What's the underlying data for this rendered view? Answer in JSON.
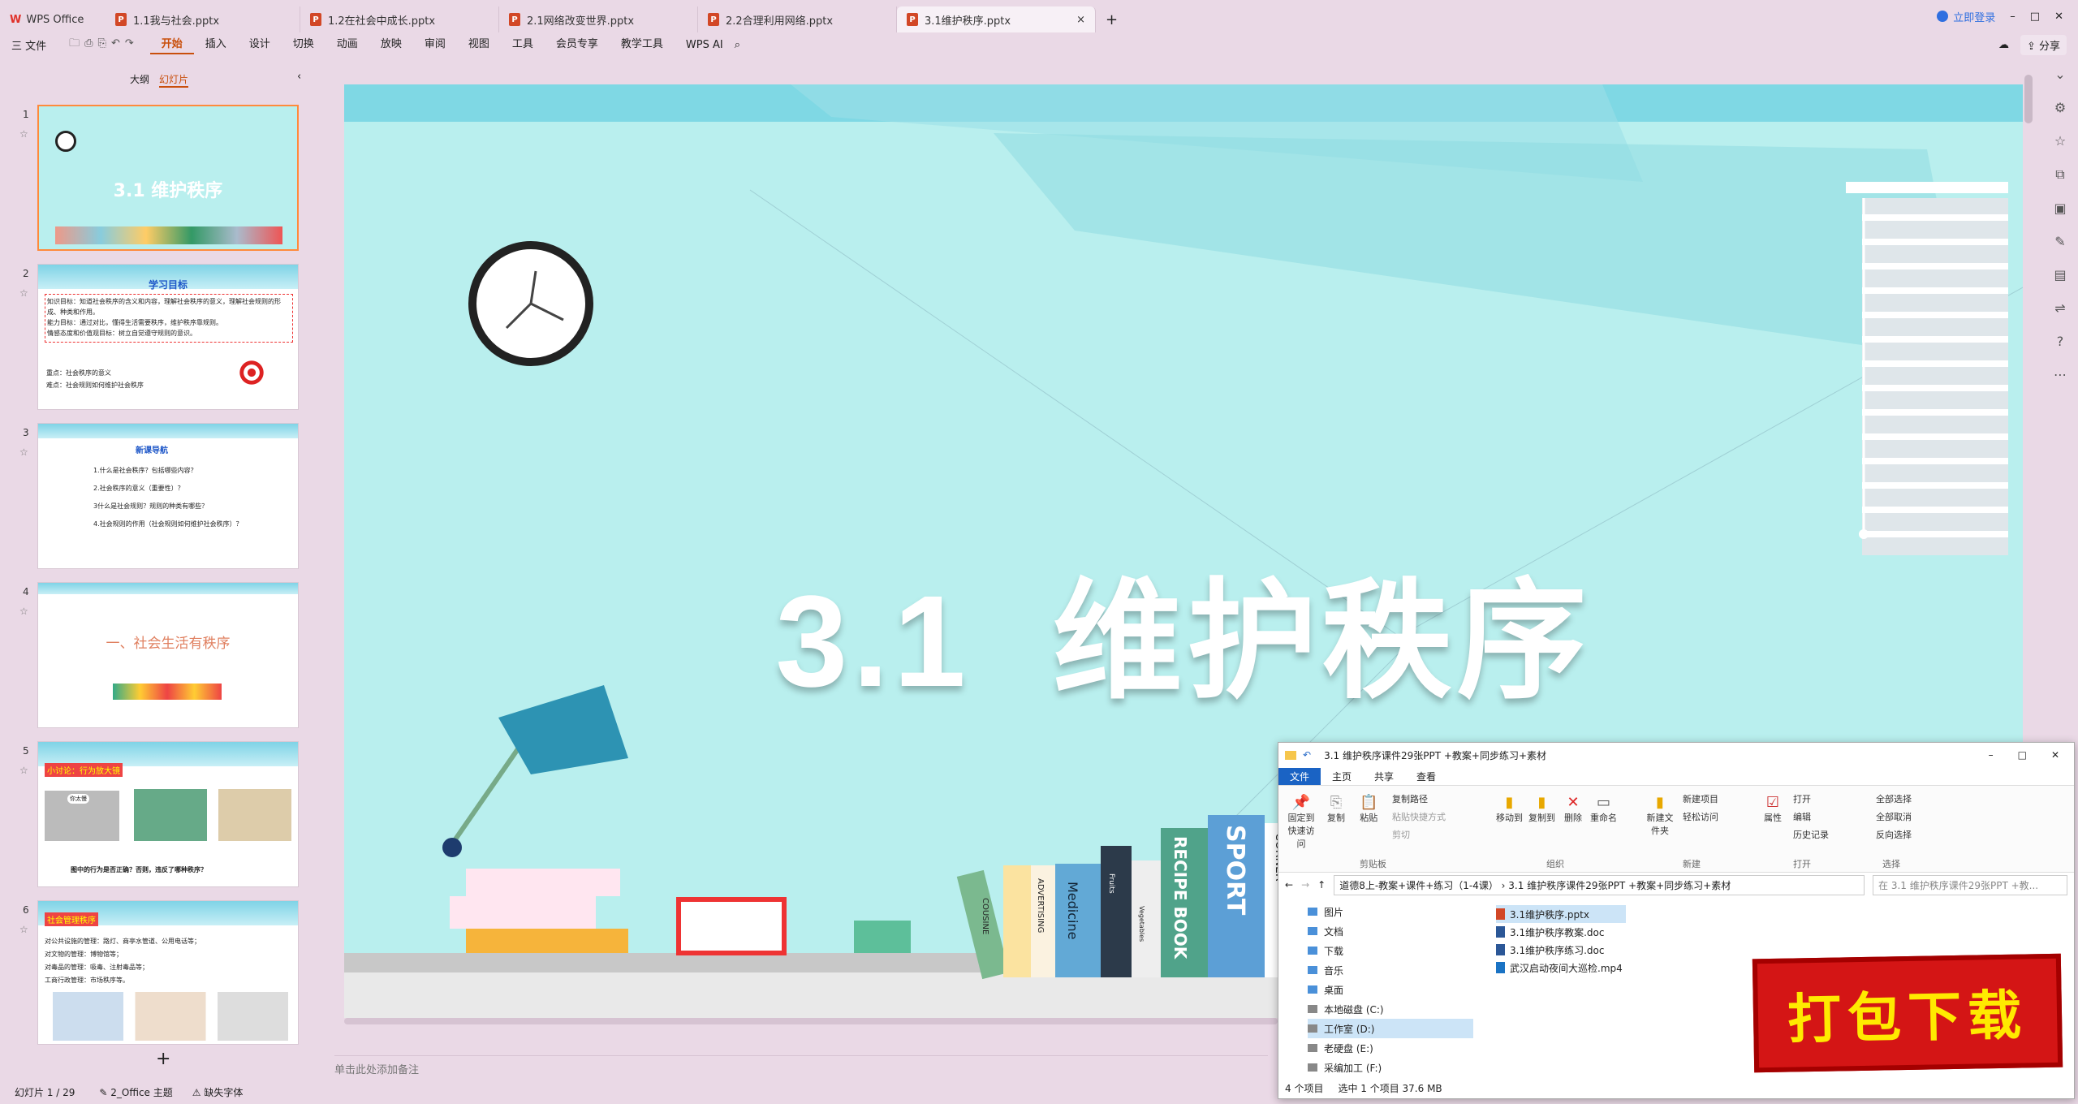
{
  "tabs": {
    "wps": "WPS Office",
    "t1": "1.1我与社会.pptx",
    "t2": "1.2在社会中成长.pptx",
    "t3": "2.1网络改变世界.pptx",
    "t4": "2.2合理利用网络.pptx",
    "t5": "3.1维护秩序.pptx",
    "login": "立即登录"
  },
  "menu": {
    "file": "三 文件",
    "items": [
      "开始",
      "插入",
      "设计",
      "切换",
      "动画",
      "放映",
      "审阅",
      "视图",
      "工具",
      "会员专享",
      "教学工具"
    ],
    "ai": "WPS AI",
    "share": "分享"
  },
  "panel": {
    "outline": "大纲",
    "slides": "幻灯片"
  },
  "thumbs": {
    "s1": {
      "num": "1",
      "title": "3.1 维护秩序"
    },
    "s2": {
      "num": "2",
      "title": "学习目标",
      "l1": "知识目标：知道社会秩序的含义和内容，理解社会秩序的意义，理解社会规则的形成、种类和作用。",
      "l2": "能力目标：通过对比，懂得生活需要秩序，维护秩序靠规则。",
      "l3": "情感态度和价值观目标：树立自觉遵守规则的意识。",
      "k1": "重点：社会秩序的意义",
      "k2": "难点：社会规则如何维护社会秩序"
    },
    "s3": {
      "num": "3",
      "title": "新课导航",
      "q1": "1.什么是社会秩序？包括哪些内容？",
      "q2": "2.社会秩序的意义（重要性）？",
      "q3": "3什么是社会规则？规则的种类有哪些？",
      "q4": "4.社会规则的作用（社会规则如何维护社会秩序）？"
    },
    "s4": {
      "num": "4",
      "title": "一、社会生活有秩序"
    },
    "s5": {
      "num": "5",
      "title": "小讨论：行为放大镜",
      "bubble": "你太慢",
      "q": "图中的行为是否正确？否则，违反了哪种秩序？"
    },
    "s6": {
      "num": "6",
      "title": "社会管理秩序",
      "l1": "对公共设施的管理：路灯、商亭水管道、公用电话等；",
      "l2": "对文物的管理：博物馆等；",
      "l3": "对毒品的管理：吸毒、注射毒品等；",
      "l4": "工商行政管理：市场秩序等。"
    }
  },
  "slide": {
    "title": "3.1  维护秩序",
    "books": [
      "COUSINE",
      "ADVERTISING",
      "Medicine",
      "Fruits",
      "Vegetables",
      "RECIPE BOOK",
      "SPORT",
      "CORNER"
    ]
  },
  "notes": "单击此处添加备注",
  "status": {
    "slide": "幻灯片 1 / 29",
    "theme": "2_Office 主题",
    "font": "缺失字体"
  },
  "explorer": {
    "title": "3.1 维护秩序课件29张PPT +教案+同步练习+素材",
    "tabs": [
      "文件",
      "主页",
      "共享",
      "查看"
    ],
    "ribbon": {
      "pin": "固定到快速访问",
      "copy": "复制",
      "paste": "粘贴",
      "copypath": "复制路径",
      "pasteshortcut": "粘贴快捷方式",
      "cut": "剪切",
      "clipboard": "剪贴板",
      "moveto": "移动到",
      "copyto": "复制到",
      "delete": "删除",
      "rename": "重命名",
      "organize": "组织",
      "newfolder": "新建文件夹",
      "newitem": "新建项目",
      "easyaccess": "轻松访问",
      "new": "新建",
      "properties": "属性",
      "open": "打开",
      "edit": "编辑",
      "history": "历史记录",
      "opengroup": "打开",
      "selectall": "全部选择",
      "selectnone": "全部取消",
      "invert": "反向选择",
      "select": "选择"
    },
    "path": "道德8上-教案+课件+练习（1-4课） › 3.1 维护秩序课件29张PPT +教案+同步练习+素材",
    "search": "在 3.1 维护秩序课件29张PPT +教...",
    "nav": [
      "图片",
      "文档",
      "下载",
      "音乐",
      "桌面",
      "本地磁盘 (C:)",
      "工作室 (D:)",
      "老硬盘 (E:)",
      "采编加工 (F:)"
    ],
    "files": [
      "3.1维护秩序.pptx",
      "3.1维护秩序教案.doc",
      "3.1维护秩序练习.doc",
      "武汉启动夜间大巡检.mp4"
    ],
    "status1": "4 个项目",
    "status2": "选中 1 个项目  37.6 MB"
  },
  "badge": "打包下载"
}
